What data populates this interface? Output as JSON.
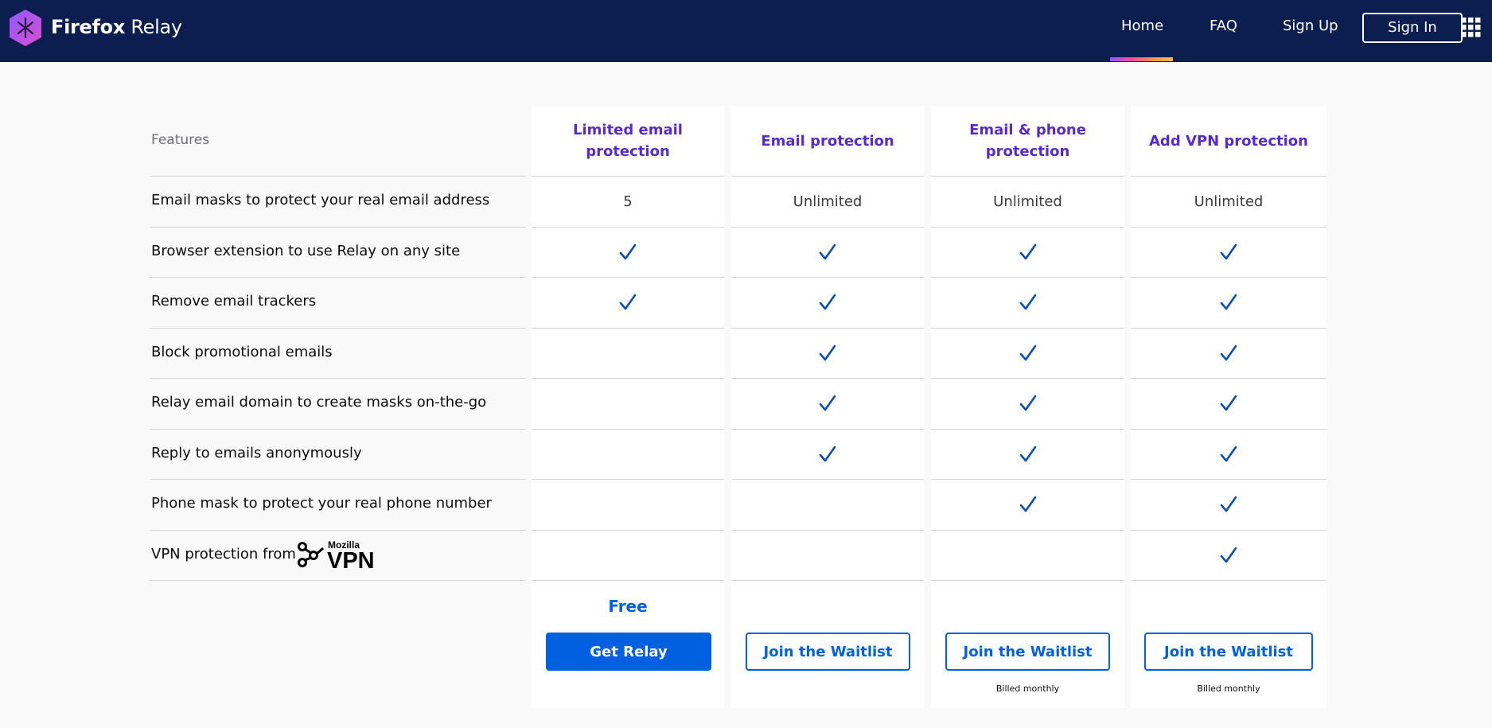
{
  "header": {
    "brand_bold": "Firefox",
    "brand_light": " Relay",
    "nav": {
      "home": "Home",
      "faq": "FAQ",
      "signup": "Sign Up",
      "signin": "Sign In"
    }
  },
  "table": {
    "features_title": "Features",
    "plans": [
      "Limited email protection",
      "Email protection",
      "Email & phone protection",
      "Add VPN protection"
    ],
    "features": [
      {
        "label": "Email masks to protect your real email address",
        "values": [
          "5",
          "Unlimited",
          "Unlimited",
          "Unlimited"
        ]
      },
      {
        "label": "Browser extension to use Relay on any site",
        "checks": [
          true,
          true,
          true,
          true
        ]
      },
      {
        "label": "Remove email trackers",
        "checks": [
          true,
          true,
          true,
          true
        ]
      },
      {
        "label": "Block promotional emails",
        "checks": [
          false,
          true,
          true,
          true
        ]
      },
      {
        "label": "Relay email domain to create masks on-the-go",
        "checks": [
          false,
          true,
          true,
          true
        ]
      },
      {
        "label": "Reply to emails anonymously",
        "checks": [
          false,
          true,
          true,
          true
        ]
      },
      {
        "label": "Phone mask to protect your real phone number",
        "checks": [
          false,
          false,
          true,
          true
        ]
      },
      {
        "label": "VPN protection from",
        "checks": [
          false,
          false,
          false,
          true
        ]
      }
    ],
    "vpn_logo": {
      "small": "Mozilla",
      "big": "VPN"
    },
    "free_price": "Free",
    "buttons": [
      "Get Relay",
      "Join the Waitlist",
      "Join the Waitlist",
      "Join the Waitlist"
    ],
    "billing_notes": [
      "",
      "",
      "Billed monthly",
      "Billed monthly"
    ]
  },
  "colors": {
    "header_bg": "#0b1e4f",
    "plan_title": "#592acb",
    "accent_blue": "#0060df",
    "check": "#0b4fb3"
  },
  "icons": [
    "firefox-relay-logo-icon",
    "apps-grid-icon",
    "checkmark-icon",
    "mozilla-vpn-logo-icon"
  ]
}
